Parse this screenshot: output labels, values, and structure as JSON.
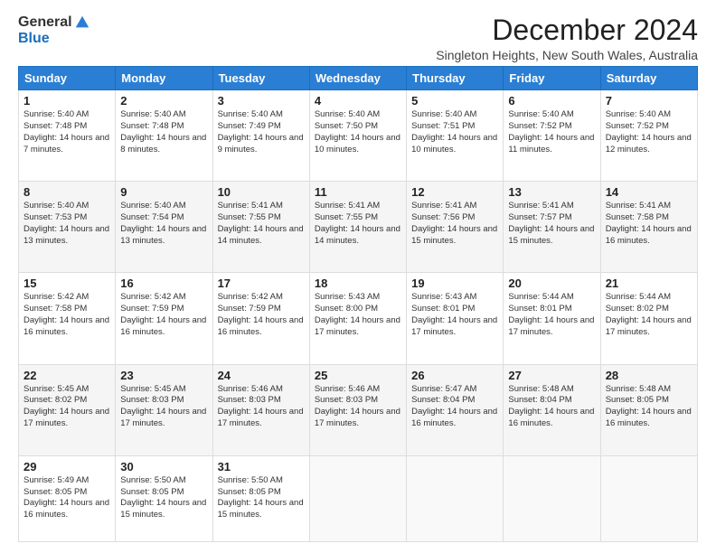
{
  "logo": {
    "general": "General",
    "blue": "Blue"
  },
  "title": "December 2024",
  "subtitle": "Singleton Heights, New South Wales, Australia",
  "days": [
    "Sunday",
    "Monday",
    "Tuesday",
    "Wednesday",
    "Thursday",
    "Friday",
    "Saturday"
  ],
  "weeks": [
    [
      {
        "num": "1",
        "sunrise": "Sunrise: 5:40 AM",
        "sunset": "Sunset: 7:48 PM",
        "daylight": "Daylight: 14 hours and 7 minutes."
      },
      {
        "num": "2",
        "sunrise": "Sunrise: 5:40 AM",
        "sunset": "Sunset: 7:48 PM",
        "daylight": "Daylight: 14 hours and 8 minutes."
      },
      {
        "num": "3",
        "sunrise": "Sunrise: 5:40 AM",
        "sunset": "Sunset: 7:49 PM",
        "daylight": "Daylight: 14 hours and 9 minutes."
      },
      {
        "num": "4",
        "sunrise": "Sunrise: 5:40 AM",
        "sunset": "Sunset: 7:50 PM",
        "daylight": "Daylight: 14 hours and 10 minutes."
      },
      {
        "num": "5",
        "sunrise": "Sunrise: 5:40 AM",
        "sunset": "Sunset: 7:51 PM",
        "daylight": "Daylight: 14 hours and 10 minutes."
      },
      {
        "num": "6",
        "sunrise": "Sunrise: 5:40 AM",
        "sunset": "Sunset: 7:52 PM",
        "daylight": "Daylight: 14 hours and 11 minutes."
      },
      {
        "num": "7",
        "sunrise": "Sunrise: 5:40 AM",
        "sunset": "Sunset: 7:52 PM",
        "daylight": "Daylight: 14 hours and 12 minutes."
      }
    ],
    [
      {
        "num": "8",
        "sunrise": "Sunrise: 5:40 AM",
        "sunset": "Sunset: 7:53 PM",
        "daylight": "Daylight: 14 hours and 13 minutes."
      },
      {
        "num": "9",
        "sunrise": "Sunrise: 5:40 AM",
        "sunset": "Sunset: 7:54 PM",
        "daylight": "Daylight: 14 hours and 13 minutes."
      },
      {
        "num": "10",
        "sunrise": "Sunrise: 5:41 AM",
        "sunset": "Sunset: 7:55 PM",
        "daylight": "Daylight: 14 hours and 14 minutes."
      },
      {
        "num": "11",
        "sunrise": "Sunrise: 5:41 AM",
        "sunset": "Sunset: 7:55 PM",
        "daylight": "Daylight: 14 hours and 14 minutes."
      },
      {
        "num": "12",
        "sunrise": "Sunrise: 5:41 AM",
        "sunset": "Sunset: 7:56 PM",
        "daylight": "Daylight: 14 hours and 15 minutes."
      },
      {
        "num": "13",
        "sunrise": "Sunrise: 5:41 AM",
        "sunset": "Sunset: 7:57 PM",
        "daylight": "Daylight: 14 hours and 15 minutes."
      },
      {
        "num": "14",
        "sunrise": "Sunrise: 5:41 AM",
        "sunset": "Sunset: 7:58 PM",
        "daylight": "Daylight: 14 hours and 16 minutes."
      }
    ],
    [
      {
        "num": "15",
        "sunrise": "Sunrise: 5:42 AM",
        "sunset": "Sunset: 7:58 PM",
        "daylight": "Daylight: 14 hours and 16 minutes."
      },
      {
        "num": "16",
        "sunrise": "Sunrise: 5:42 AM",
        "sunset": "Sunset: 7:59 PM",
        "daylight": "Daylight: 14 hours and 16 minutes."
      },
      {
        "num": "17",
        "sunrise": "Sunrise: 5:42 AM",
        "sunset": "Sunset: 7:59 PM",
        "daylight": "Daylight: 14 hours and 16 minutes."
      },
      {
        "num": "18",
        "sunrise": "Sunrise: 5:43 AM",
        "sunset": "Sunset: 8:00 PM",
        "daylight": "Daylight: 14 hours and 17 minutes."
      },
      {
        "num": "19",
        "sunrise": "Sunrise: 5:43 AM",
        "sunset": "Sunset: 8:01 PM",
        "daylight": "Daylight: 14 hours and 17 minutes."
      },
      {
        "num": "20",
        "sunrise": "Sunrise: 5:44 AM",
        "sunset": "Sunset: 8:01 PM",
        "daylight": "Daylight: 14 hours and 17 minutes."
      },
      {
        "num": "21",
        "sunrise": "Sunrise: 5:44 AM",
        "sunset": "Sunset: 8:02 PM",
        "daylight": "Daylight: 14 hours and 17 minutes."
      }
    ],
    [
      {
        "num": "22",
        "sunrise": "Sunrise: 5:45 AM",
        "sunset": "Sunset: 8:02 PM",
        "daylight": "Daylight: 14 hours and 17 minutes."
      },
      {
        "num": "23",
        "sunrise": "Sunrise: 5:45 AM",
        "sunset": "Sunset: 8:03 PM",
        "daylight": "Daylight: 14 hours and 17 minutes."
      },
      {
        "num": "24",
        "sunrise": "Sunrise: 5:46 AM",
        "sunset": "Sunset: 8:03 PM",
        "daylight": "Daylight: 14 hours and 17 minutes."
      },
      {
        "num": "25",
        "sunrise": "Sunrise: 5:46 AM",
        "sunset": "Sunset: 8:03 PM",
        "daylight": "Daylight: 14 hours and 17 minutes."
      },
      {
        "num": "26",
        "sunrise": "Sunrise: 5:47 AM",
        "sunset": "Sunset: 8:04 PM",
        "daylight": "Daylight: 14 hours and 16 minutes."
      },
      {
        "num": "27",
        "sunrise": "Sunrise: 5:48 AM",
        "sunset": "Sunset: 8:04 PM",
        "daylight": "Daylight: 14 hours and 16 minutes."
      },
      {
        "num": "28",
        "sunrise": "Sunrise: 5:48 AM",
        "sunset": "Sunset: 8:05 PM",
        "daylight": "Daylight: 14 hours and 16 minutes."
      }
    ],
    [
      {
        "num": "29",
        "sunrise": "Sunrise: 5:49 AM",
        "sunset": "Sunset: 8:05 PM",
        "daylight": "Daylight: 14 hours and 16 minutes."
      },
      {
        "num": "30",
        "sunrise": "Sunrise: 5:50 AM",
        "sunset": "Sunset: 8:05 PM",
        "daylight": "Daylight: 14 hours and 15 minutes."
      },
      {
        "num": "31",
        "sunrise": "Sunrise: 5:50 AM",
        "sunset": "Sunset: 8:05 PM",
        "daylight": "Daylight: 14 hours and 15 minutes."
      },
      null,
      null,
      null,
      null
    ]
  ]
}
